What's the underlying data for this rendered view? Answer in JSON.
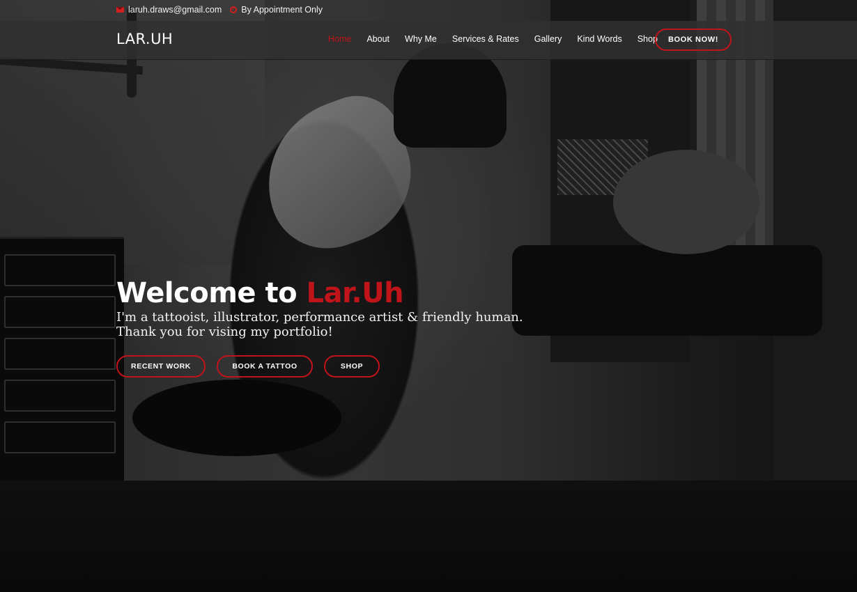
{
  "topbar": {
    "email": "laruh.draws@gmail.com",
    "hours": "By Appointment Only"
  },
  "navbar": {
    "logo": "LAR.UH",
    "items": [
      {
        "label": "Home",
        "active": true
      },
      {
        "label": "About"
      },
      {
        "label": "Why Me"
      },
      {
        "label": "Services & Rates"
      },
      {
        "label": "Gallery"
      },
      {
        "label": "Kind Words"
      },
      {
        "label": "Shop"
      }
    ],
    "book_label": "BOOK NOW!"
  },
  "hero": {
    "welcome_prefix": "Welcome to ",
    "welcome_brand": "Lar.Uh",
    "tagline_line1": "I'm a tattooist, illustrator, performance artist & friendly human.",
    "tagline_line2": "Thank you for vising my portfolio!",
    "buttons": [
      {
        "label": "RECENT WORK"
      },
      {
        "label": "BOOK A TATTOO"
      },
      {
        "label": "SHOP"
      }
    ]
  },
  "theme": {
    "accent": "#c0141b",
    "icons": [
      "envelope-icon",
      "clock-icon"
    ]
  }
}
